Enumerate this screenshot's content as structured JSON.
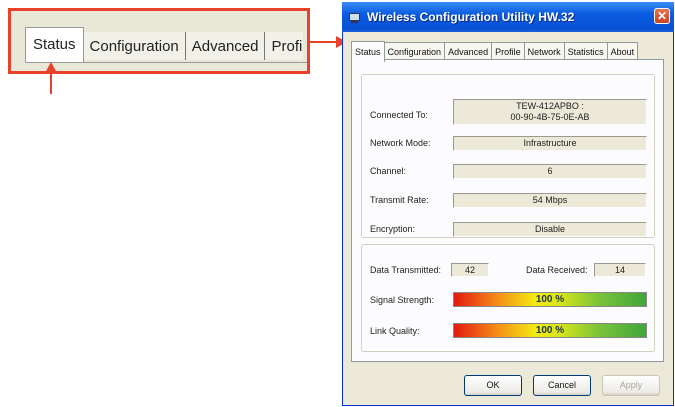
{
  "zoom": {
    "tabs": [
      "Status",
      "Configuration",
      "Advanced",
      "Profi"
    ]
  },
  "window": {
    "title": "Wireless Configuration Utility HW.32",
    "close_glyph": "✕",
    "tabs": [
      "Status",
      "Configuration",
      "Advanced",
      "Profile",
      "Network",
      "Statistics",
      "About"
    ],
    "active_tab": "Status"
  },
  "status": {
    "connected_to": {
      "label": "Connected To:",
      "value_line1": "TEW-412APBO :",
      "value_line2": "00-90-4B-75-0E-AB"
    },
    "network_mode": {
      "label": "Network Mode:",
      "value": "Infrastructure"
    },
    "channel": {
      "label": "Channel:",
      "value": "6"
    },
    "transmit_rate": {
      "label": "Transmit Rate:",
      "value": "54 Mbps"
    },
    "encryption": {
      "label": "Encryption:",
      "value": "Disable"
    },
    "data_transmitted": {
      "label": "Data Transmitted:",
      "value": "42"
    },
    "data_received": {
      "label": "Data Received:",
      "value": "14"
    },
    "signal_strength": {
      "label": "Signal Strength:",
      "value_text": "100 %",
      "value": 100
    },
    "link_quality": {
      "label": "Link Quality:",
      "value_text": "100 %",
      "value": 100
    }
  },
  "buttons": {
    "ok": "OK",
    "cancel": "Cancel",
    "apply": "Apply"
  },
  "colors": {
    "callout": "#e8422a",
    "titlebar": "#0a5ce0",
    "window_bg": "#ece9d8"
  }
}
